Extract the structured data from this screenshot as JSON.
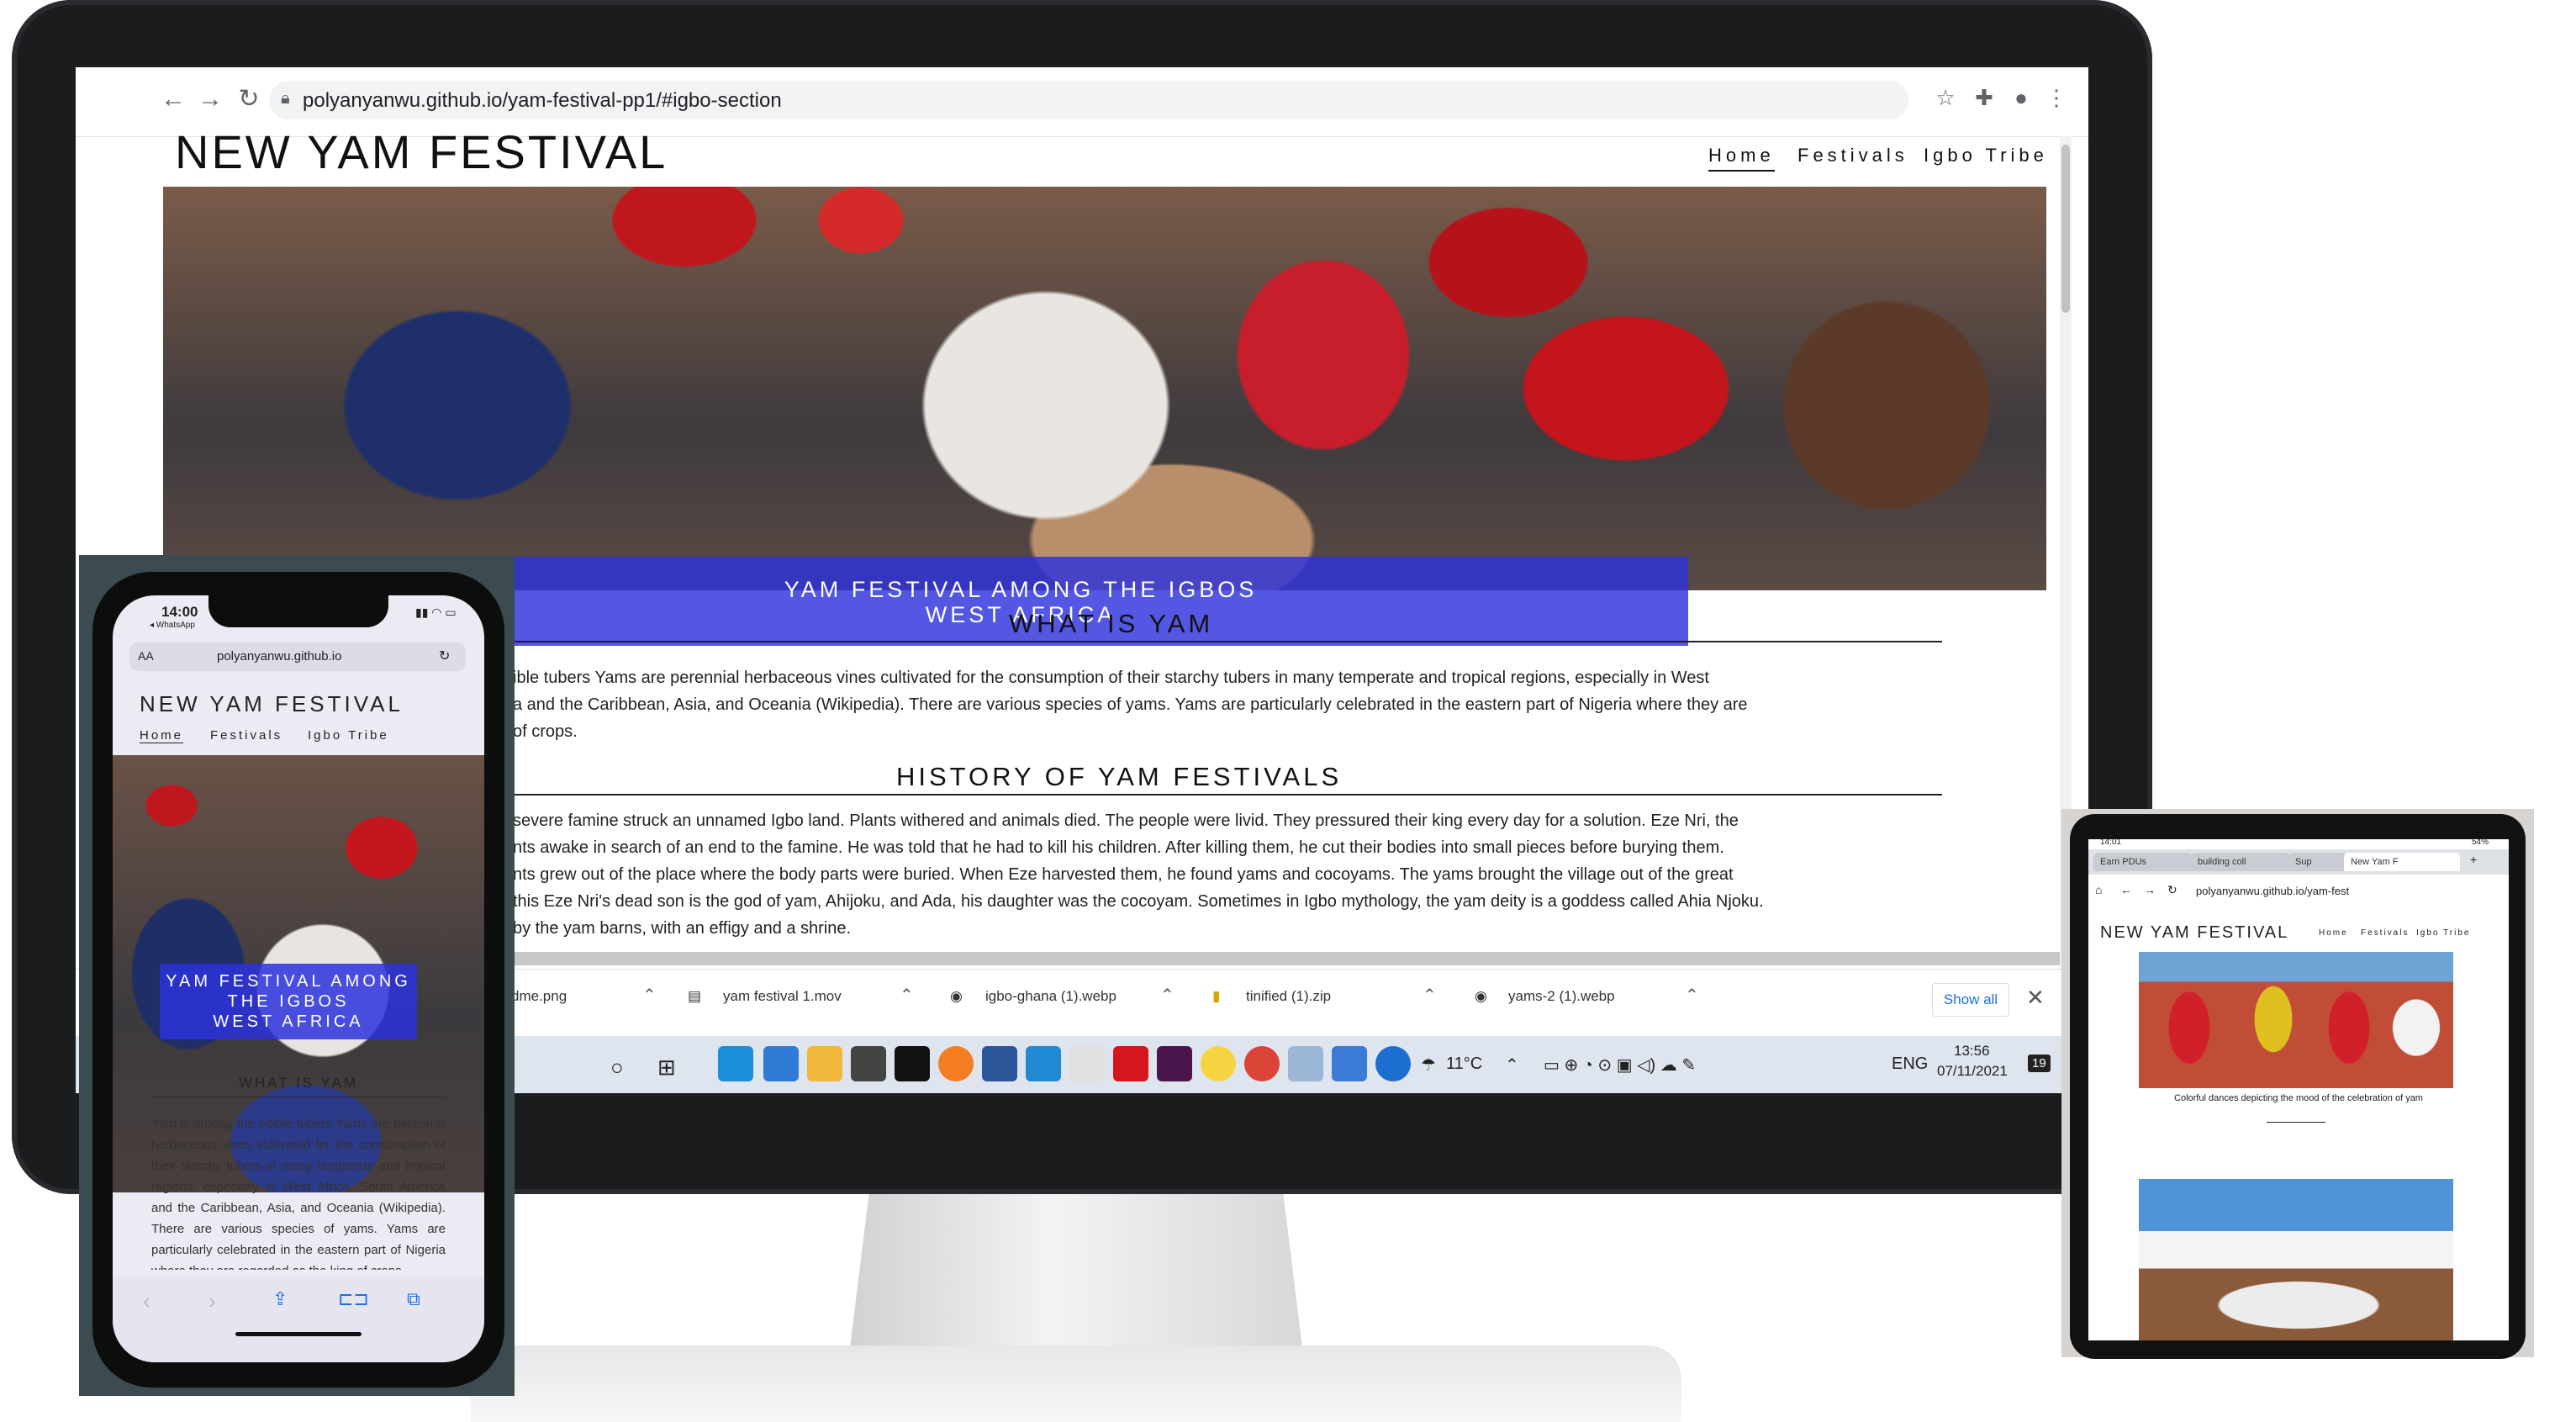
{
  "browser": {
    "url": "polyanyanwu.github.io/yam-festival-pp1/#igbo-section"
  },
  "site": {
    "title": "NEW YAM FESTIVAL",
    "nav": [
      "Home",
      "Festivals",
      "Igbo Tribe"
    ],
    "hero_line1": "YAM FESTIVAL AMONG THE IGBOS",
    "hero_line2": "WEST AFRICA",
    "section1_title": "WHAT IS YAM",
    "section1_lines": [
      "ible tubers Yams are perennial herbaceous vines cultivated for the consumption of their starchy tubers in many temperate and tropical regions, especially in West",
      "a and the Caribbean, Asia, and Oceania (Wikipedia). There are various species of yams. Yams are particularly celebrated in the eastern part of Nigeria where they are",
      "of crops."
    ],
    "section2_title": "HISTORY OF YAM FESTIVALS",
    "section2_lines": [
      "severe famine struck an unnamed Igbo land. Plants withered and animals died. The people were livid. They pressured their king every day for a solution. Eze Nri, the",
      "nts awake in search of an end to the famine. He was told that he had to kill his children. After killing them, he cut their bodies into small pieces before burying them.",
      "nts grew out of the place where the body parts were buried. When Eze harvested them, he found yams and cocoyams. The yams brought the village out of the great",
      "this Eze Nri's dead son is the god of yam, Ahijoku, and Ada, his daughter was the cocoyam. Sometimes in Igbo mythology, the yam deity is a goddess called Ahia Njoku.",
      "by the yam barns, with an effigy and a shrine."
    ]
  },
  "downloads": {
    "items": [
      "dme.png",
      "yam festival 1.mov",
      "igbo-ghana (1).webp",
      "tinified (1).zip",
      "yams-2 (1).webp"
    ],
    "show_all": "Show all"
  },
  "taskbar": {
    "weather": "11°C",
    "lang": "ENG",
    "time": "13:56",
    "date": "07/11/2021",
    "notif_count": "19"
  },
  "phone": {
    "time": "14:00",
    "back_app": "◂ WhatsApp",
    "aa": "AA",
    "url": "polyanyanwu.github.io",
    "title": "NEW YAM FESTIVAL",
    "nav": [
      "Home",
      "Festivals",
      "Igbo Tribe"
    ],
    "banner_lines": [
      "YAM FESTIVAL AMONG",
      "THE IGBOS",
      "WEST AFRICA"
    ],
    "section_title": "WHAT IS YAM",
    "paragraph": "Yam is among the edible tubers Yams are perennial herbaceous vines cultivated for the consumption of their starchy tubers in many temperate and tropical regions, especially in West Africa, South America and the Caribbean, Asia, and Oceania (Wikipedia). There are various species of yams. Yams are particularly celebrated in the eastern part of Nigeria where they are regarded as the king of crops."
  },
  "tablet": {
    "status_time": "14:01",
    "battery": "54%",
    "tabs": [
      "Earn PDUs",
      "building coll",
      "Sup",
      "New Yam F"
    ],
    "url": "polyanyanwu.github.io/yam-fest",
    "title": "NEW YAM FESTIVAL",
    "nav": [
      "Home",
      "Festivals",
      "Igbo Tribe"
    ],
    "caption": "Colorful dances depicting the mood of the celebration of yam"
  }
}
